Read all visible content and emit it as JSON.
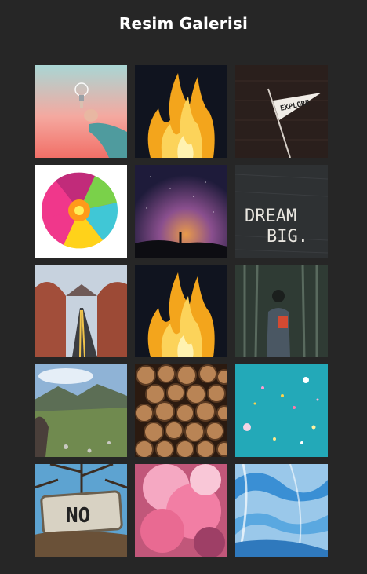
{
  "page": {
    "title": "Resim Galerisi"
  },
  "gallery": {
    "items": [
      {
        "name": "lightbulb-photo"
      },
      {
        "name": "fire-photo"
      },
      {
        "name": "explore-flag-photo",
        "text": "EXPLORE"
      },
      {
        "name": "colorful-flower-photo"
      },
      {
        "name": "milky-way-photo"
      },
      {
        "name": "dream-big-photo",
        "text_line1": "DREAM",
        "text_line2": "BIG."
      },
      {
        "name": "desert-road-photo"
      },
      {
        "name": "fire-photo-2"
      },
      {
        "name": "forest-person-photo"
      },
      {
        "name": "mountain-meadow-photo"
      },
      {
        "name": "firewood-logs-photo"
      },
      {
        "name": "confetti-water-photo"
      },
      {
        "name": "no-sign-photo",
        "text": "NO"
      },
      {
        "name": "pink-smoke-photo"
      },
      {
        "name": "blue-marble-photo"
      }
    ]
  }
}
